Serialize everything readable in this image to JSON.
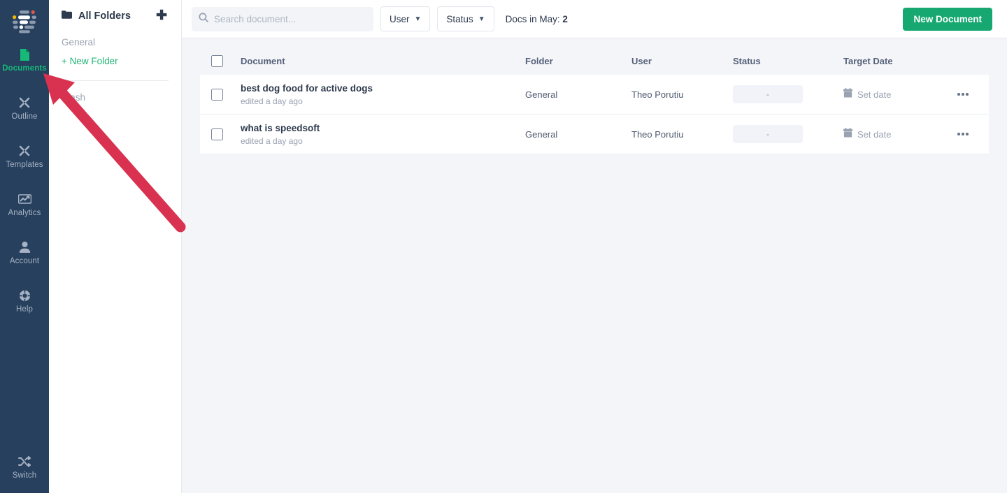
{
  "rail": {
    "logo_icon": "document-list-logo",
    "items": [
      {
        "label": "Documents",
        "icon": "document-icon",
        "active": true
      },
      {
        "label": "Outline",
        "icon": "outline-tools-icon",
        "active": false
      },
      {
        "label": "Templates",
        "icon": "templates-tools-icon",
        "active": false
      },
      {
        "label": "Analytics",
        "icon": "analytics-chart-icon",
        "active": false
      },
      {
        "label": "Account",
        "icon": "user-account-icon",
        "active": false
      },
      {
        "label": "Help",
        "icon": "help-circle-icon",
        "active": false
      }
    ],
    "bottom_item": {
      "label": "Switch",
      "icon": "switch-shuffle-icon"
    }
  },
  "folders": {
    "title": "All Folders",
    "folder_icon": "folder-icon",
    "add_icon": "plus-icon",
    "items": [
      {
        "label": "General"
      }
    ],
    "new_folder_label": "+ New Folder",
    "trash_label": "Trash"
  },
  "topbar": {
    "search_placeholder": "Search document...",
    "search_value": "",
    "search_icon": "search-icon",
    "user_filter_label": "User",
    "status_filter_label": "Status",
    "chevron_icon": "chevron-down-icon",
    "docs_count_label": "Docs in May:",
    "docs_count_value": "2",
    "new_document_label": "New Document"
  },
  "table": {
    "columns": {
      "document": "Document",
      "folder": "Folder",
      "user": "User",
      "status": "Status",
      "target_date": "Target Date"
    },
    "rows": [
      {
        "title": "best dog food for active dogs",
        "subtitle": "edited a day ago",
        "folder": "General",
        "user": "Theo Porutiu",
        "status": "-",
        "date_label": "Set date",
        "date_icon": "calendar-icon",
        "more_icon": "more-horizontal-icon"
      },
      {
        "title": "what is speedsoft",
        "subtitle": "edited a day ago",
        "folder": "General",
        "user": "Theo Porutiu",
        "status": "-",
        "date_label": "Set date",
        "date_icon": "calendar-icon",
        "more_icon": "more-horizontal-icon"
      }
    ]
  },
  "annotation": {
    "arrow_color": "#d93250",
    "arrow_icon": "pointer-arrow-annotation"
  },
  "colors": {
    "rail_bg": "#26405e",
    "accent_green": "#16a870",
    "page_bg": "#f4f5f8"
  }
}
